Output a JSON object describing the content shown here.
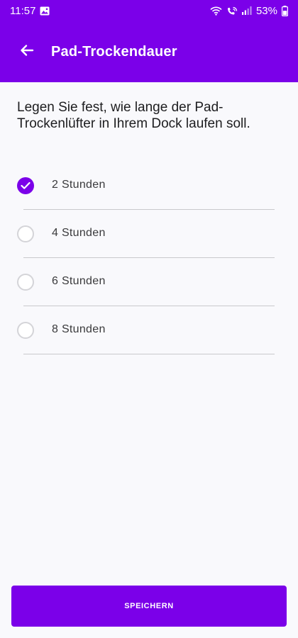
{
  "status_bar": {
    "time": "11:57",
    "battery": "53%",
    "icons": [
      "gallery-icon",
      "wifi-icon",
      "wifi-calling-icon",
      "signal-icon",
      "battery-icon"
    ]
  },
  "app_bar": {
    "title": "Pad-Trockendauer",
    "back_icon": "arrow-left-icon"
  },
  "description": "Legen Sie fest, wie lange der Pad-Trockenlüfter in Ihrem Dock laufen soll.",
  "options": [
    {
      "label": "2 Stunden",
      "selected": true
    },
    {
      "label": "4 Stunden",
      "selected": false
    },
    {
      "label": "6 Stunden",
      "selected": false
    },
    {
      "label": "8 Stunden",
      "selected": false
    }
  ],
  "save_button": {
    "label": "SPEICHERN"
  },
  "colors": {
    "accent": "#7b00e9",
    "background": "#f9f9fc",
    "divider": "#c9c9cc",
    "radio_border": "#d4d4d8"
  }
}
